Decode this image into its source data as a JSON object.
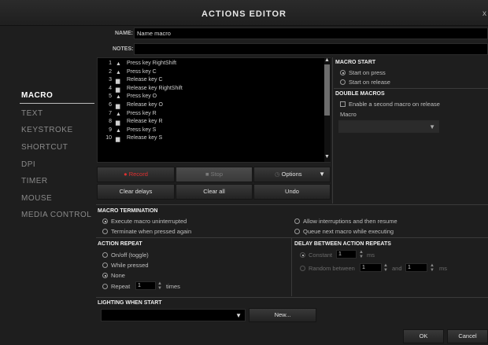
{
  "window": {
    "title": "ACTIONS EDITOR",
    "close": "x"
  },
  "nav": [
    "MACRO",
    "TEXT",
    "KEYSTROKE",
    "SHORTCUT",
    "DPI",
    "TIMER",
    "MOUSE",
    "MEDIA CONTROL"
  ],
  "name": {
    "label": "NAME:",
    "value": "Name macro"
  },
  "notes": {
    "label": "NOTES:",
    "value": ""
  },
  "actions": [
    {
      "n": "1",
      "icon": "up",
      "text": "Press key RightShift"
    },
    {
      "n": "2",
      "icon": "up",
      "text": "Press key C"
    },
    {
      "n": "3",
      "icon": "down",
      "text": "Release key C"
    },
    {
      "n": "4",
      "icon": "down",
      "text": "Release key RightShift"
    },
    {
      "n": "5",
      "icon": "up",
      "text": "Press key O"
    },
    {
      "n": "6",
      "icon": "down",
      "text": "Release key O"
    },
    {
      "n": "7",
      "icon": "up",
      "text": "Press key R"
    },
    {
      "n": "8",
      "icon": "down",
      "text": "Release key R"
    },
    {
      "n": "9",
      "icon": "up",
      "text": "Press key S"
    },
    {
      "n": "10",
      "icon": "down",
      "text": "Release key S"
    }
  ],
  "buttons": {
    "record": "Record",
    "stop": "Stop",
    "options": "Options",
    "clear_delays": "Clear delays",
    "clear_all": "Clear all",
    "undo": "Undo",
    "new": "New...",
    "ok": "OK",
    "cancel": "Cancel"
  },
  "macro_start": {
    "title": "MACRO START",
    "on_press": "Start on press",
    "on_release": "Start on release"
  },
  "double_macros": {
    "title": "DOUBLE MACROS",
    "enable": "Enable a second macro on release",
    "macro_label": "Macro"
  },
  "termination": {
    "title": "MACRO TERMINATION",
    "opt1": "Execute macro uninterrupted",
    "opt2": "Terminate when pressed again",
    "opt3": "Allow interruptions and then resume",
    "opt4": "Queue next macro while executing"
  },
  "repeat": {
    "title": "ACTION REPEAT",
    "onoff": "On/off (toggle)",
    "while": "While pressed",
    "none": "None",
    "repeat": "Repeat",
    "repeat_value": "1",
    "times": "times"
  },
  "delay": {
    "title": "DELAY BETWEEN ACTION REPEATS",
    "constant": "Constant",
    "constant_value": "1",
    "ms": "ms",
    "random": "Random between",
    "rand_min": "1",
    "and": "and",
    "rand_max": "1",
    "ms2": "ms"
  },
  "lighting": {
    "title": "LIGHTING WHEN START"
  },
  "colors": {
    "record_red": "#e03030",
    "accent": "#ffffff"
  }
}
